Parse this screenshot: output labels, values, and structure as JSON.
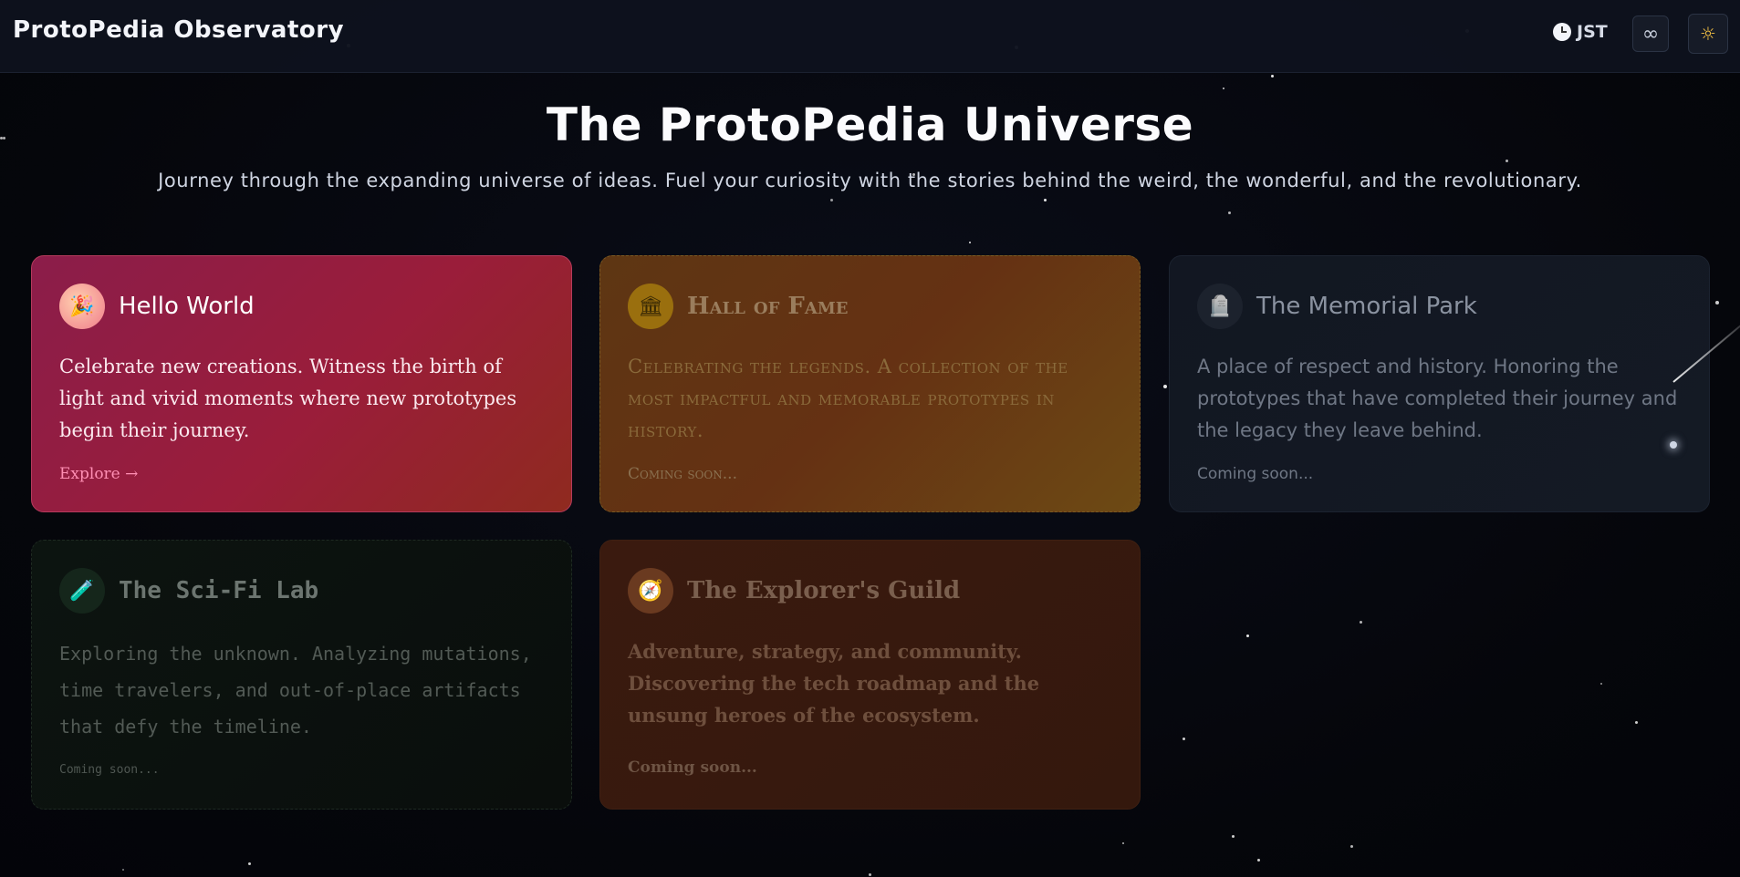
{
  "header": {
    "brand": "ProtoPedia Observatory",
    "timezone": "JST",
    "loop_button_icon": "infinity-icon",
    "theme_button_icon": "sun-icon"
  },
  "hero": {
    "title": "The ProtoPedia Universe",
    "subtitle": "Journey through the expanding universe of ideas. Fuel your curiosity with the stories behind the weird, the wonderful, and the revolutionary."
  },
  "cards": [
    {
      "icon": "party-popper-icon",
      "icon_glyph": "🎉",
      "title": "Hello World",
      "description": "Celebrate new creations. Witness the birth of light and vivid moments where new prototypes begin their journey.",
      "cta": "Explore →"
    },
    {
      "icon": "museum-icon",
      "icon_glyph": "🏛",
      "title": "Hall of Fame",
      "description": "Celebrating the legends. A collection of the most impactful and memorable prototypes in history.",
      "cta": "Coming soon..."
    },
    {
      "icon": "headstone-icon",
      "icon_glyph": "🪦",
      "title": "The Memorial Park",
      "description": "A place of respect and history. Honoring the prototypes that have completed their journey and the legacy they leave behind.",
      "cta": "Coming soon..."
    },
    {
      "icon": "test-tube-icon",
      "icon_glyph": "🧪",
      "title": "The Sci-Fi Lab",
      "description": "Exploring the unknown. Analyzing mutations, time travelers, and out-of-place artifacts that defy the timeline.",
      "cta": "Coming soon..."
    },
    {
      "icon": "compass-icon",
      "icon_glyph": "🧭",
      "title": "The Explorer's Guild",
      "description": "Adventure, strategy, and community. Discovering the tech roadmap and the unsung heroes of the ecosystem.",
      "cta": "Coming soon..."
    }
  ],
  "colors": {
    "background": "#05060b",
    "accent_pink": "#ff8fb4",
    "sun": "#f6c244"
  }
}
